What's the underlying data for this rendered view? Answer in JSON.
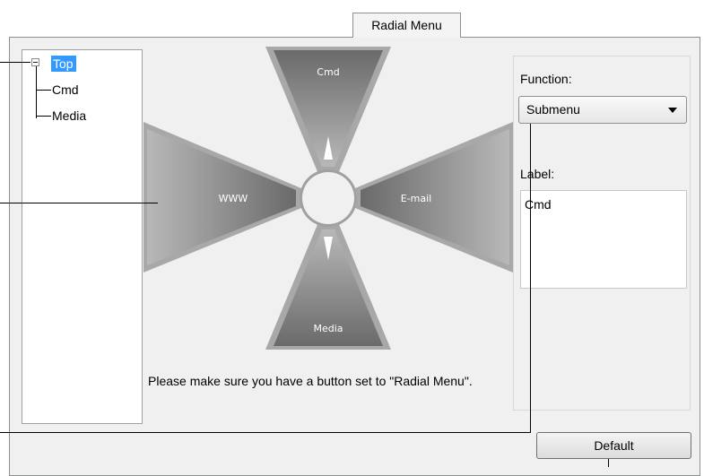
{
  "tab": {
    "label": "Radial Menu"
  },
  "tree": {
    "items": [
      {
        "label": "Top",
        "selected": true
      },
      {
        "label": "Cmd"
      },
      {
        "label": "Media"
      }
    ]
  },
  "radial_menu": {
    "wedges": {
      "top": "Cmd",
      "left": "WWW",
      "right": "E-mail",
      "bottom": "Media"
    }
  },
  "function": {
    "label": "Function:",
    "selected": "Submenu"
  },
  "label_field": {
    "label": "Label:",
    "value": "Cmd"
  },
  "note": "Please make sure you have a button set to \"Radial Menu\".",
  "default_button": {
    "label": "Default"
  },
  "colors": {
    "selection": "#3399ff",
    "panel_bg": "#f0f0f0"
  }
}
